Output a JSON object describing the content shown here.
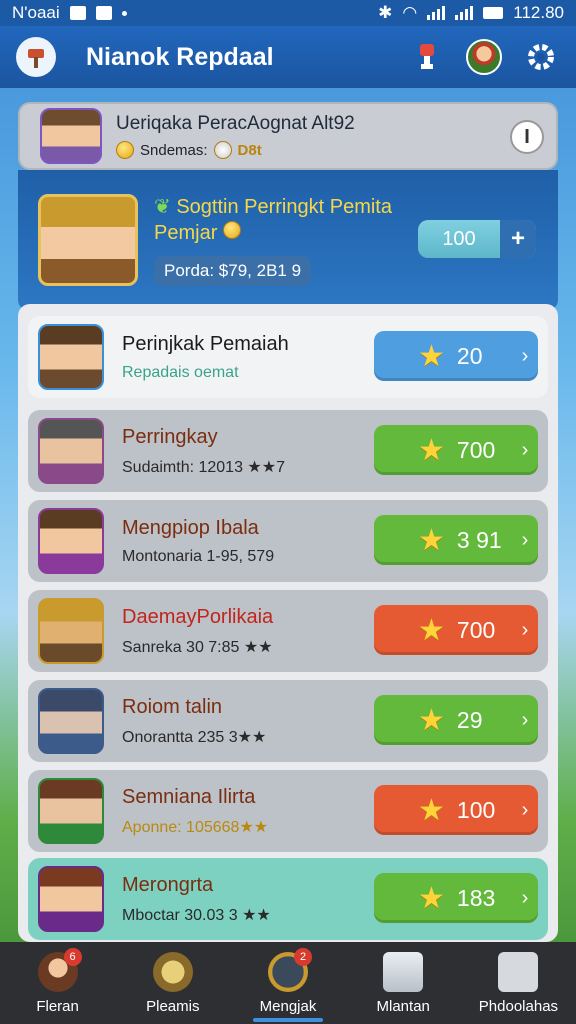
{
  "status_bar": {
    "carrier": "N'oaai",
    "time": "112.80"
  },
  "app_bar": {
    "title": "Nianok Repdaal"
  },
  "summary": {
    "title": "Ueriqaka PeracAognat Alt92",
    "subtitle": "Sndemas:",
    "coins": "D8t",
    "info_label": "I"
  },
  "featured": {
    "title_line1": "Sogttin Perringkt Pemita",
    "title_line2": "Pemjar",
    "price": "Porda: $79, 2B1 9",
    "counter_value": "100",
    "counter_plus": "+"
  },
  "rows": [
    {
      "title": "Perinjkak Pemaiah",
      "subtitle": "Repadais   oemat",
      "value": "20",
      "color": "#4f9ee0"
    },
    {
      "title": "Perringkay",
      "subtitle": "Sudaimth: 12013 ★★7",
      "value": "700",
      "color": "#63b93b"
    },
    {
      "title": "Mengpiop Ibala",
      "subtitle": "Montonaria 1-95, 579",
      "value": "3 91",
      "color": "#63b93b"
    },
    {
      "title": "DaemayPorlikaia",
      "subtitle": "Sanreka 30 7:85 ★★",
      "value": "700",
      "color": "#e65a33"
    },
    {
      "title": "Roiom talin",
      "subtitle": "Onorantta 235 3★★",
      "value": "29",
      "color": "#63b93b"
    },
    {
      "title": "Semniana Ilirta",
      "subtitle": "Aponne: 105668★★",
      "value": "100",
      "color": "#e65a33"
    },
    {
      "title": "Merongrta",
      "subtitle": "Mboctar 30.03 3 ★★",
      "value": "183",
      "color": "#63b93b"
    }
  ],
  "nav": [
    {
      "label": "Fleran",
      "icon": "avatar-icon"
    },
    {
      "label": "Pleamis",
      "icon": "brush-icon"
    },
    {
      "label": "Mengjak",
      "icon": "compass-icon"
    },
    {
      "label": "Mlantan",
      "icon": "notepad-icon"
    },
    {
      "label": "Phdoolahas",
      "icon": "grid-icon"
    }
  ],
  "colors": {
    "app_bar": "#1b55a0",
    "green_badge": "#63b93b",
    "orange_badge": "#e65a33",
    "blue_badge": "#4f9ee0"
  }
}
